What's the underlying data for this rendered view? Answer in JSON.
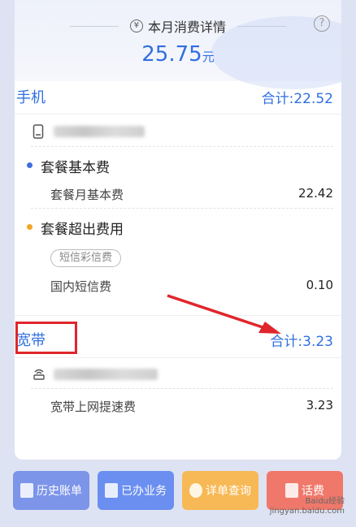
{
  "header": {
    "title": "本月消费详情",
    "yen_symbol": "¥",
    "help_symbol": "?",
    "total_amount": "25.75",
    "total_unit": "元"
  },
  "mobile": {
    "title": "手机",
    "total": "合计:22.52",
    "groups": [
      {
        "title": "套餐基本费",
        "dot_color": "#3f6fdf",
        "items": [
          {
            "label": "套餐月基本费",
            "amount": "22.42"
          }
        ]
      },
      {
        "title": "套餐超出费用",
        "dot_color": "#f5a524",
        "tag": "短信彩信费",
        "items": [
          {
            "label": "国内短信费",
            "amount": "0.10"
          }
        ]
      }
    ]
  },
  "broadband": {
    "title": "宽带",
    "total": "合计:3.23",
    "items": [
      {
        "label": "宽带上网提速费",
        "amount": "3.23"
      }
    ]
  },
  "bottom_buttons": [
    {
      "label": "历史账单",
      "color": "#7c95e9"
    },
    {
      "label": "已办业务",
      "color": "#6b8ff0"
    },
    {
      "label": "详单查询",
      "color": "#f7b955"
    },
    {
      "label": "话费",
      "color": "#f0786a"
    }
  ],
  "watermark": {
    "line1": "Baidu经验",
    "line2": "jingyan.baidu.com"
  }
}
